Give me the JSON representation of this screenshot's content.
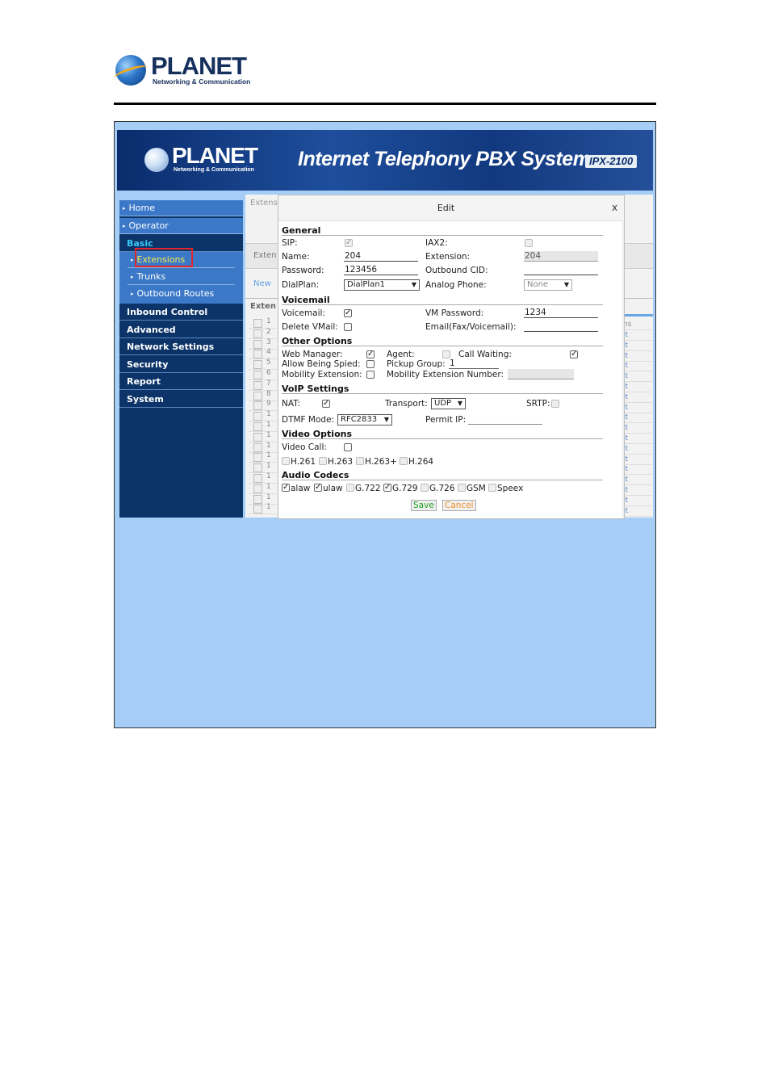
{
  "doc": {
    "logo_word": "PLANET",
    "logo_tagline": "Networking & Communication"
  },
  "banner": {
    "logo_word": "PLANET",
    "logo_tagline": "Networking & Communication",
    "title": "Internet Telephony PBX System",
    "model": "IPX-2100"
  },
  "sidebar": {
    "home": "Home",
    "operator": "Operator",
    "basic": "Basic",
    "sub_items": [
      "Extensions",
      "Trunks",
      "Outbound Routes"
    ],
    "sections": [
      "Inbound Control",
      "Advanced",
      "Network Settings",
      "Security",
      "Report",
      "System"
    ]
  },
  "background": {
    "breadcrumb": "Extens",
    "tab": "Exten",
    "new_button": "New",
    "table_title": "Exten",
    "row_numbers": [
      "1",
      "2",
      "3",
      "4",
      "5",
      "6",
      "7",
      "8",
      "9",
      "1",
      "1",
      "1",
      "1",
      "1",
      "1",
      "1",
      "1",
      "1",
      "1"
    ],
    "right_header": "ns",
    "right_cell": "it"
  },
  "colors": {
    "accent": "#37c8f8",
    "highlight": "#e0262b",
    "save": "#1aa01a",
    "cancel": "#f0902a"
  },
  "modal": {
    "title": "Edit",
    "close": "x",
    "general": {
      "heading": "General",
      "sip_label": "SIP:",
      "iax2_label": "IAX2:",
      "name_label": "Name:",
      "name_value": "204",
      "extension_label": "Extension:",
      "extension_value": "204",
      "password_label": "Password:",
      "password_value": "123456",
      "outbound_cid_label": "Outbound CID:",
      "dialplan_label": "DialPlan:",
      "dialplan_value": "DialPlan1",
      "analog_phone_label": "Analog Phone:",
      "analog_phone_value": "None"
    },
    "voicemail": {
      "heading": "Voicemail",
      "voicemail_label": "Voicemail:",
      "vm_password_label": "VM Password:",
      "vm_password_value": "1234",
      "delete_vmail_label": "Delete VMail:",
      "email_label": "Email(Fax/Voicemail):"
    },
    "other": {
      "heading": "Other Options",
      "web_manager_label": "Web Manager:",
      "agent_label": "Agent:",
      "call_waiting_label": "Call Waiting:",
      "allow_spied_label": "Allow Being Spied:",
      "pickup_group_label": "Pickup Group:",
      "pickup_group_value": "1",
      "mobility_ext_label": "Mobility Extension:",
      "mobility_ext_number_label": "Mobility Extension Number:"
    },
    "voip": {
      "heading": "VoIP Settings",
      "nat_label": "NAT:",
      "transport_label": "Transport:",
      "transport_value": "UDP",
      "srtp_label": "SRTP:",
      "dtmf_label": "DTMF Mode:",
      "dtmf_value": "RFC2833",
      "permit_ip_label": "Permit IP:"
    },
    "video": {
      "heading": "Video Options",
      "video_call_label": "Video Call:",
      "codecs": [
        "H.261",
        "H.263",
        "H.263+",
        "H.264"
      ]
    },
    "audio": {
      "heading": "Audio Codecs",
      "codecs": [
        "alaw",
        "ulaw",
        "G.722",
        "G.729",
        "G.726",
        "GSM",
        "Speex"
      ]
    },
    "save_label": "Save",
    "cancel_label": "Cancel"
  }
}
